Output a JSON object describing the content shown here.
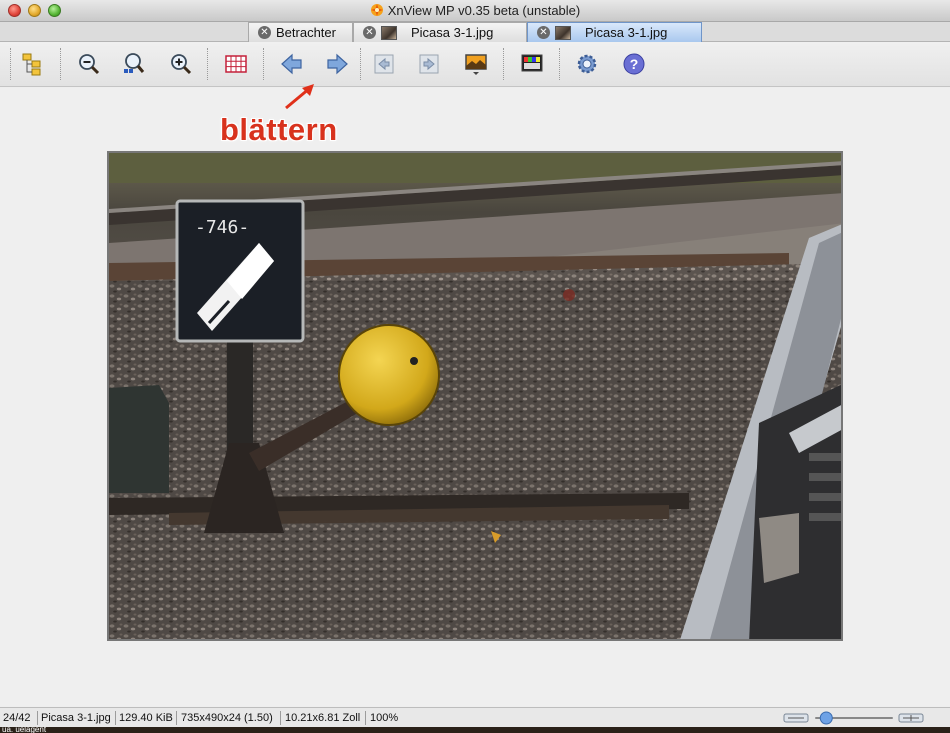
{
  "window": {
    "title": "XnView MP v0.35 beta (unstable)",
    "app_icon": "xnview-logo-icon"
  },
  "tabs": [
    {
      "label": "Betrachter",
      "active": false,
      "has_thumbnail": false
    },
    {
      "label": "Picasa 3-1.jpg",
      "active": false,
      "has_thumbnail": true
    },
    {
      "label": "Picasa 3-1.jpg",
      "active": true,
      "has_thumbnail": true
    }
  ],
  "toolbar": {
    "buttons": [
      {
        "name": "browser-tree-button",
        "icon": "folder-tree-icon"
      },
      {
        "name": "zoom-out-button",
        "icon": "zoom-out-icon"
      },
      {
        "name": "zoom-fit-button",
        "icon": "zoom-fit-icon"
      },
      {
        "name": "zoom-in-button",
        "icon": "zoom-in-icon"
      },
      {
        "name": "grid-button",
        "icon": "grid-icon"
      },
      {
        "name": "previous-button",
        "icon": "arrow-left-icon"
      },
      {
        "name": "next-button",
        "icon": "arrow-right-icon"
      },
      {
        "name": "first-button",
        "icon": "first-page-icon"
      },
      {
        "name": "last-button",
        "icon": "last-page-icon"
      },
      {
        "name": "slideshow-button",
        "icon": "slideshow-icon"
      },
      {
        "name": "color-adjust-button",
        "icon": "color-palette-icon"
      },
      {
        "name": "settings-button",
        "icon": "gear-icon"
      },
      {
        "name": "help-button",
        "icon": "help-icon"
      }
    ]
  },
  "annotation": {
    "text": "blättern",
    "color": "#d8321d"
  },
  "image": {
    "description_icon": "railway-photo",
    "sign_number": "-746-"
  },
  "statusbar": {
    "position": "24/42",
    "filename": "Picasa 3-1.jpg",
    "filesize": "129.40 KiB",
    "dimensions": "735x490x24 (1.50)",
    "print_size": "10.21x6.81 Zoll",
    "zoom": "100%",
    "zoom_slider_fraction": 0.08
  },
  "bottom_strip": {
    "text": "ua. uelagent"
  }
}
